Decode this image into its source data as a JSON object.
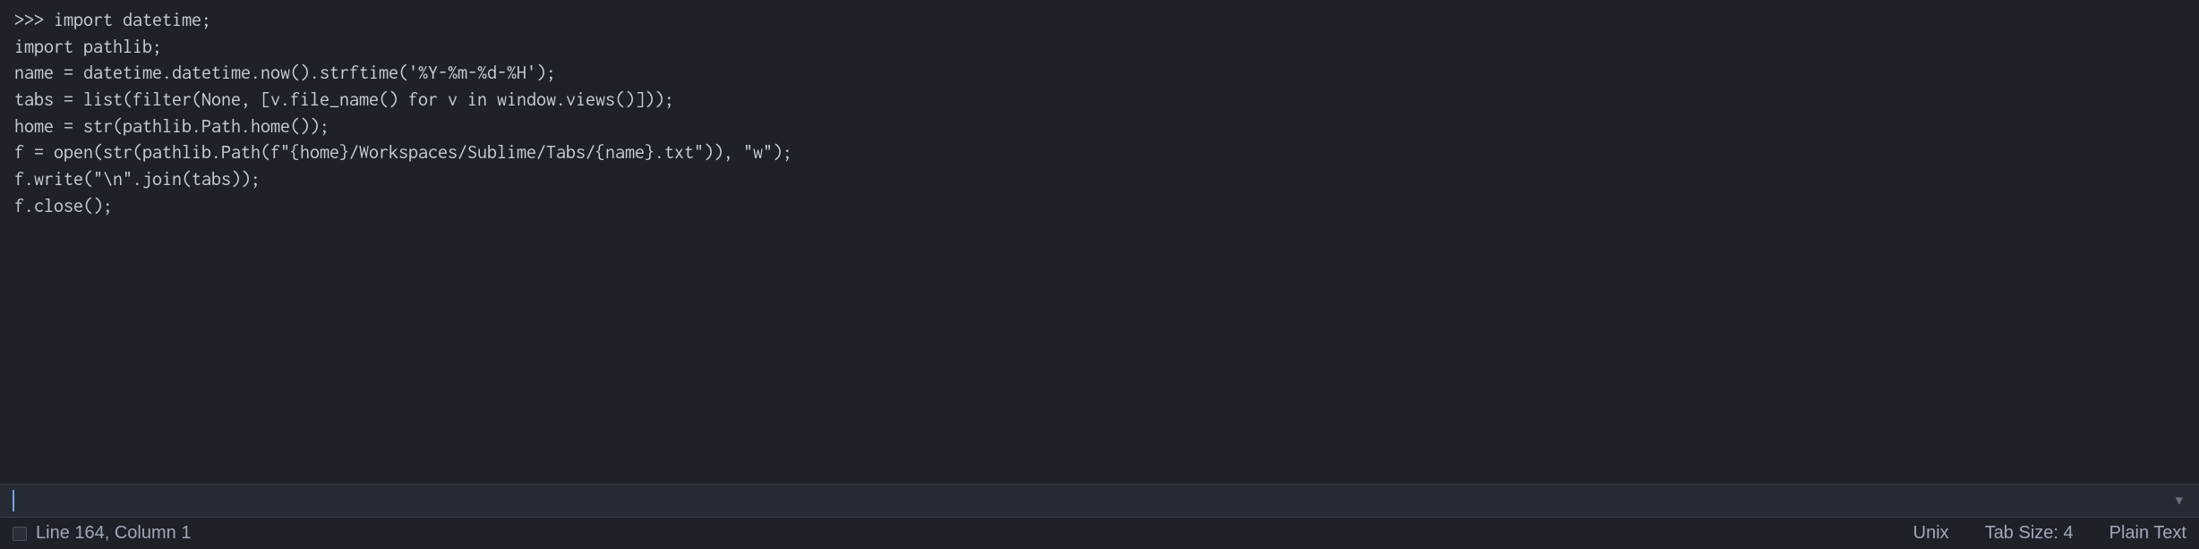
{
  "console": {
    "prompt": ">>> ",
    "lines": [
      "import datetime;",
      "import pathlib;",
      "name = datetime.datetime.now().strftime('%Y-%m-%d-%H');",
      "tabs = list(filter(None, [v.file_name() for v in window.views()]));",
      "home = str(pathlib.Path.home());",
      "f = open(str(pathlib.Path(f\"{home}/Workspaces/Sublime/Tabs/{name}.txt\")), \"w\");",
      "f.write(\"\\n\".join(tabs));",
      "f.close();"
    ],
    "input_value": ""
  },
  "status": {
    "position": "Line 164, Column 1",
    "line_endings": "Unix",
    "tab_size": "Tab Size: 4",
    "syntax": "Plain Text"
  },
  "icons": {
    "dropdown": "▼"
  }
}
